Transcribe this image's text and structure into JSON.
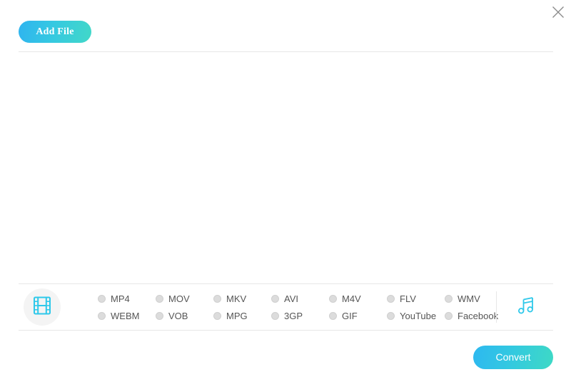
{
  "window": {
    "close_icon": "close-icon"
  },
  "toolbar": {
    "add_file_label": "Add File"
  },
  "content": {
    "file_list_empty": ""
  },
  "format_panel": {
    "video_icon": "film-strip-icon",
    "audio_icon": "music-note-icon",
    "selected_format": "",
    "columns": [
      {
        "row1": "MP4",
        "row2": "WEBM"
      },
      {
        "row1": "MOV",
        "row2": "VOB"
      },
      {
        "row1": "MKV",
        "row2": "MPG"
      },
      {
        "row1": "AVI",
        "row2": "3GP"
      },
      {
        "row1": "M4V",
        "row2": "GIF"
      },
      {
        "row1": "FLV",
        "row2": "YouTube"
      },
      {
        "row1": "WMV",
        "row2": "Facebook"
      }
    ]
  },
  "footer": {
    "convert_label": "Convert"
  },
  "colors": {
    "accent_start": "#2db8f0",
    "accent_end": "#3ed9c5",
    "icon_cyan": "#2ec8ea",
    "rule": "#e7e7e7",
    "radio": "#dcdcdc",
    "label_text": "#555555"
  }
}
